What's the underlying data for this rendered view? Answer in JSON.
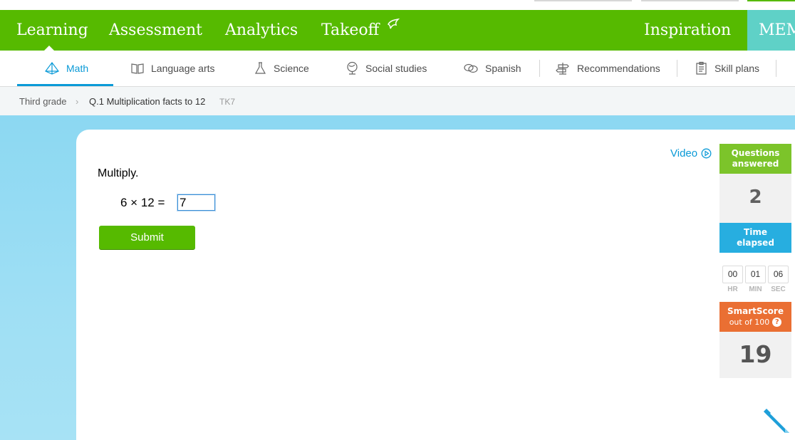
{
  "main_nav": {
    "items": [
      "Learning",
      "Assessment",
      "Analytics",
      "Takeoff"
    ],
    "right_item": "Inspiration",
    "member": "MEM"
  },
  "sub_nav": {
    "tabs": [
      {
        "label": "Math",
        "icon": "pyramid-icon"
      },
      {
        "label": "Language arts",
        "icon": "book-icon"
      },
      {
        "label": "Science",
        "icon": "flask-icon"
      },
      {
        "label": "Social studies",
        "icon": "globe-icon"
      },
      {
        "label": "Spanish",
        "icon": "speech-bubbles-icon"
      },
      {
        "label": "Recommendations",
        "icon": "signpost-icon"
      },
      {
        "label": "Skill plans",
        "icon": "clipboard-icon"
      }
    ]
  },
  "breadcrumb": {
    "grade": "Third grade",
    "skill": "Q.1 Multiplication facts to 12",
    "code": "TK7"
  },
  "question": {
    "video_label": "Video",
    "prompt": "Multiply.",
    "equation": "6 × 12 =",
    "answer_value": "7",
    "submit_label": "Submit"
  },
  "sidebar": {
    "questions_answered_label_1": "Questions",
    "questions_answered_label_2": "answered",
    "questions_answered": "2",
    "time_elapsed_label_1": "Time",
    "time_elapsed_label_2": "elapsed",
    "time": {
      "hr": "00",
      "min": "01",
      "sec": "06"
    },
    "time_units": {
      "hr": "HR",
      "min": "MIN",
      "sec": "SEC"
    },
    "smartscore_label": "SmartScore",
    "smartscore_sub": "out of 100",
    "smartscore_help": "?",
    "smartscore": "19"
  },
  "colors": {
    "brand_green": "#56ba00",
    "accent_blue": "#0a9ad7",
    "smartscore_orange": "#ea6f33",
    "member_teal": "#5fd1c7"
  }
}
